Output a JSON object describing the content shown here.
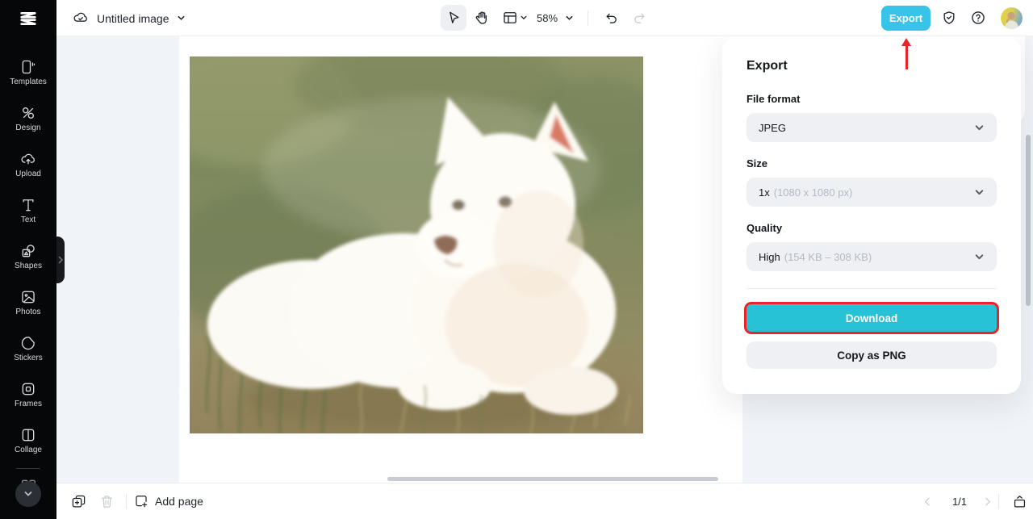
{
  "topbar": {
    "project_name": "Untitled image",
    "zoom_level": "58%",
    "export_label": "Export"
  },
  "sidebar": {
    "items": [
      {
        "label": "Templates",
        "icon": "templates-icon"
      },
      {
        "label": "Design",
        "icon": "design-icon"
      },
      {
        "label": "Upload",
        "icon": "upload-icon"
      },
      {
        "label": "Text",
        "icon": "text-icon"
      },
      {
        "label": "Shapes",
        "icon": "shapes-icon"
      },
      {
        "label": "Photos",
        "icon": "photos-icon"
      },
      {
        "label": "Stickers",
        "icon": "stickers-icon"
      },
      {
        "label": "Frames",
        "icon": "frames-icon"
      },
      {
        "label": "Collage",
        "icon": "collage-icon"
      }
    ]
  },
  "export_panel": {
    "title": "Export",
    "file_format": {
      "label": "File format",
      "value": "JPEG"
    },
    "size": {
      "label": "Size",
      "value": "1x",
      "detail": "(1080 x 1080 px)"
    },
    "quality": {
      "label": "Quality",
      "value": "High",
      "detail": "(154 KB – 308 KB)"
    },
    "download_label": "Download",
    "copy_png_label": "Copy as PNG"
  },
  "bottombar": {
    "add_page_label": "Add page",
    "page_indicator": "1/1"
  },
  "canvas": {
    "content_description": "White fluffy puppy lying on grass"
  },
  "colors": {
    "export_button": "#38c3e8",
    "download_button": "#28c2d6",
    "annotation_red": "#e8262a",
    "sidebar_bg": "#060709",
    "panel_field_bg": "#eef0f4",
    "workspace_bg": "#f0f3f7"
  }
}
